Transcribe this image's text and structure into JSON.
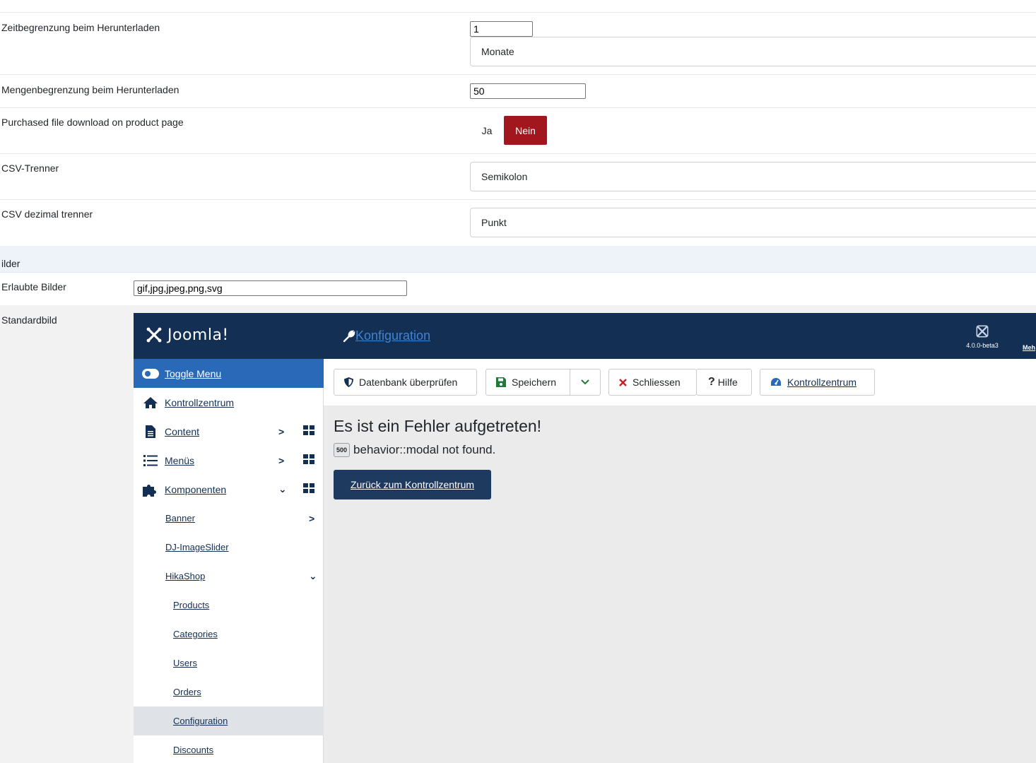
{
  "form": {
    "download_time_label": "Zeitbegrenzung beim Herunterladen",
    "download_time_value": "1",
    "download_time_unit": "Monate",
    "download_limit_label": "Mengenbegrenzung beim Herunterladen",
    "download_limit_value": "50",
    "purchased_download_label": "Purchased file download on product page",
    "toggle_yes": "Ja",
    "toggle_no": "Nein",
    "csv_separator_label": "CSV-Trenner",
    "csv_separator_value": "Semikolon",
    "csv_decimal_label": "CSV dezimal trenner",
    "csv_decimal_value": "Punkt"
  },
  "images_section": {
    "heading": "ilder",
    "allowed_label": "Erlaubte Bilder",
    "allowed_value": "gif,jpg,jpeg,png,svg",
    "default_label": "Standardbild"
  },
  "joomla": {
    "logo_text": "Joomla!",
    "title": "Konfiguration",
    "version": "4.0.0-beta3",
    "more": "Meh",
    "sidebar": {
      "toggle": "Toggle Menu",
      "dashboard": "Kontrollzentrum",
      "content": "Content",
      "menus": "Menüs",
      "components": "Komponenten",
      "banner": "Banner",
      "djslider": "DJ-ImageSlider",
      "hikashop": "HikaShop",
      "products": "Products",
      "categories": "Categories",
      "users": "Users",
      "orders": "Orders",
      "configuration": "Configuration",
      "discounts": "Discounts"
    },
    "toolbar": {
      "check_db": "Datenbank überprüfen",
      "save": "Speichern",
      "close": "Schliessen",
      "help": "Hilfe",
      "dashboard": "Kontrollzentrum"
    },
    "error": {
      "title": "Es ist ein Fehler aufgetreten!",
      "code": "500",
      "message": "behavior::modal not found.",
      "back": "Zurück zum Kontrollzentrum"
    }
  },
  "colors": {
    "header": "#132f53",
    "active_menu": "#2a69b8",
    "toggle_no": "#a2161d",
    "back_button": "#1e3a5f"
  }
}
